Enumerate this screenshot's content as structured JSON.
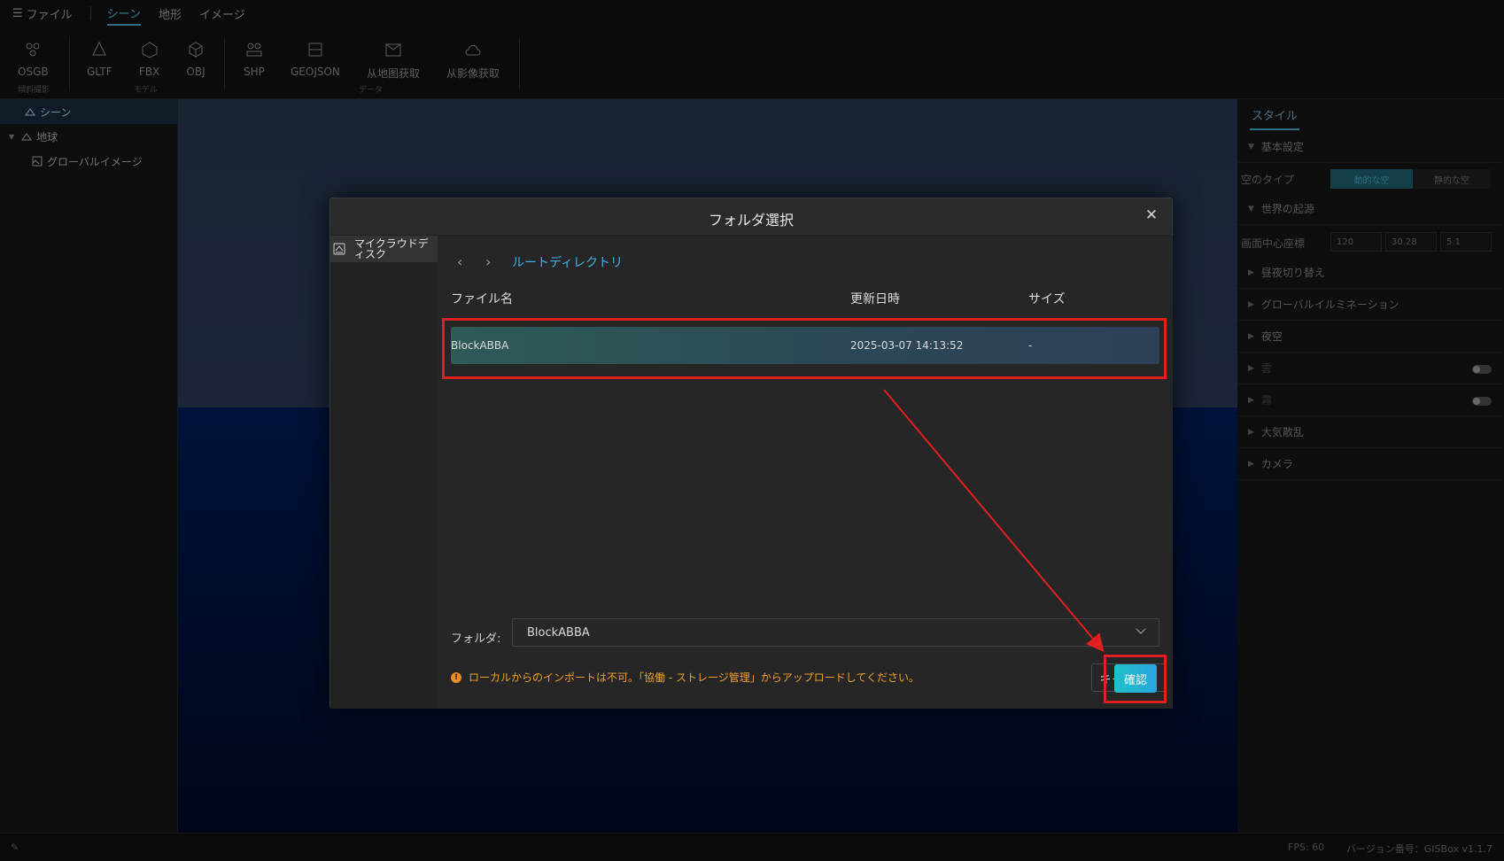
{
  "menu": {
    "file_label": "ファイル",
    "items": [
      {
        "label": "シーン"
      },
      {
        "label": "地形"
      },
      {
        "label": "イメージ"
      }
    ]
  },
  "ribbon": {
    "buttons": [
      {
        "label": "OSGB",
        "icon": "osgb-icon"
      },
      {
        "label": "GLTF",
        "icon": "gltf-icon"
      },
      {
        "label": "FBX",
        "icon": "fbx-icon"
      },
      {
        "label": "OBJ",
        "icon": "obj-icon"
      },
      {
        "label": "SHP",
        "icon": "shp-icon"
      },
      {
        "label": "GEOJSON",
        "icon": "geojson-icon"
      },
      {
        "label": "从地图获取",
        "icon": "map-fetch-icon"
      },
      {
        "label": "从影像获取",
        "icon": "imagery-fetch-icon"
      }
    ],
    "groups": [
      "傾斜撮影",
      "モデル",
      "データ"
    ]
  },
  "tree": {
    "items": [
      {
        "label": "シーン",
        "icon": "scene-icon"
      },
      {
        "label": "地球",
        "icon": "globe-icon"
      },
      {
        "label": "グローバルイメージ",
        "icon": "global-image-icon"
      }
    ]
  },
  "right_panel": {
    "tab": "スタイル",
    "sections": {
      "basic": "基本設定",
      "sky_type_label": "空のタイプ",
      "sky_dynamic": "動的な空",
      "sky_static": "静的な空",
      "world_origin": "世界の起源",
      "center_label": "画面中心座標",
      "coords": [
        "120",
        "30.28",
        "5.1"
      ],
      "day_night": "昼夜切り替え",
      "global_illumination": "グローバルイルミネーション",
      "night_sky": "夜空",
      "cloud": "雲",
      "fog": "霧",
      "atmosphere": "大気散乱",
      "camera": "カメラ"
    }
  },
  "status": {
    "fps": "FPS: 60",
    "version": "バージョン番号：GISBox v1.1.7"
  },
  "modal": {
    "title": "フォルダ選択",
    "disk_label": "マイクラウドディスク",
    "breadcrumb": "ルートディレクトリ",
    "columns": {
      "name": "ファイル名",
      "modified": "更新日時",
      "size": "サイズ"
    },
    "files": [
      {
        "name": "BlockABBA",
        "modified": "2025-03-07 14:13:52",
        "size": "-"
      }
    ],
    "folder_label": "フォルダ:",
    "folder_value": "BlockABBA",
    "warning": "ローカルからのインポートは不可。「協働 - ストレージ管理」からアップロードしてください。",
    "cancel_label": "キャンセル",
    "confirm_label": "確認"
  },
  "colors": {
    "accent": "#2aa6e0",
    "highlight": "#e02020",
    "warning": "#f0a02a"
  }
}
